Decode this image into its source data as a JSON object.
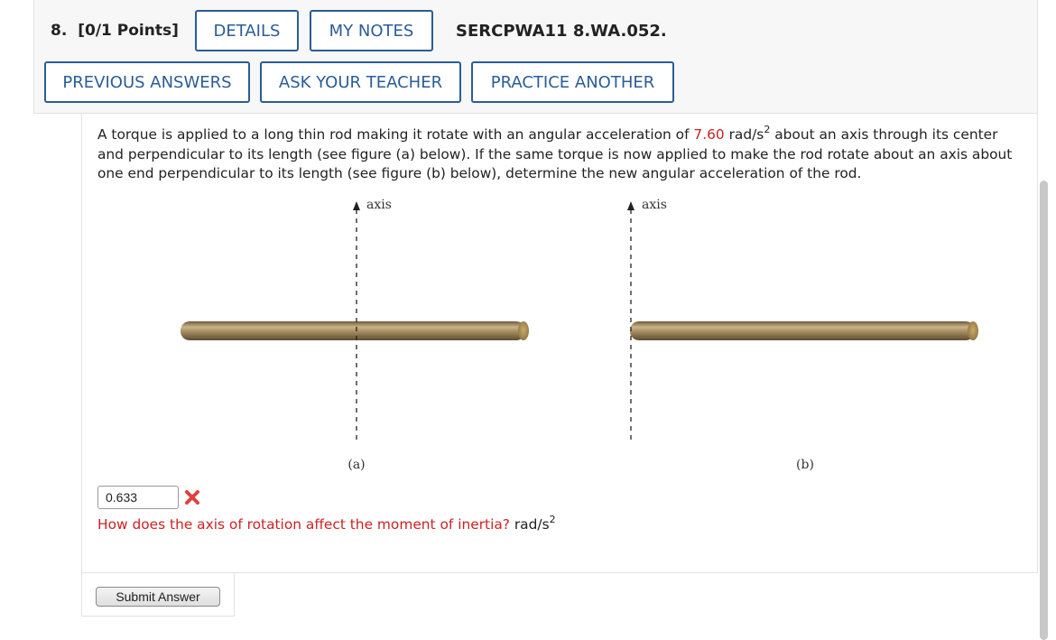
{
  "question": {
    "number_label": "8.",
    "points_label": "[0/1 Points]",
    "code": "SERCPWA11 8.WA.052."
  },
  "buttons": {
    "details": "DETAILS",
    "my_notes": "MY NOTES",
    "previous_answers": "PREVIOUS ANSWERS",
    "ask_teacher": "ASK YOUR TEACHER",
    "practice_another": "PRACTICE ANOTHER",
    "submit": "Submit Answer"
  },
  "problem": {
    "text_before_value": "A torque is applied to a long thin rod making it rotate with an angular acceleration of ",
    "value": "7.60",
    "unit_base": " rad/s",
    "unit_exp": "2",
    "text_after_value": " about an axis through its center and perpendicular to its length (see figure (a) below). If the same torque is now applied to make the rod rotate about an axis about one end perpendicular to its length (see figure (b) below), determine the new angular acceleration of the rod."
  },
  "figure": {
    "axis_label_a": "axis",
    "axis_label_b": "axis",
    "caption_a": "(a)",
    "caption_b": "(b)"
  },
  "answer": {
    "value": "0.633",
    "status": "incorrect",
    "status_icon": "x-mark-icon",
    "hint": "How does the axis of rotation affect the moment of inertia?",
    "unit_base": "rad/s",
    "unit_exp": "2"
  },
  "colors": {
    "accent": "#2a5d97",
    "error": "#cc2222",
    "rod": "#9b8259"
  }
}
